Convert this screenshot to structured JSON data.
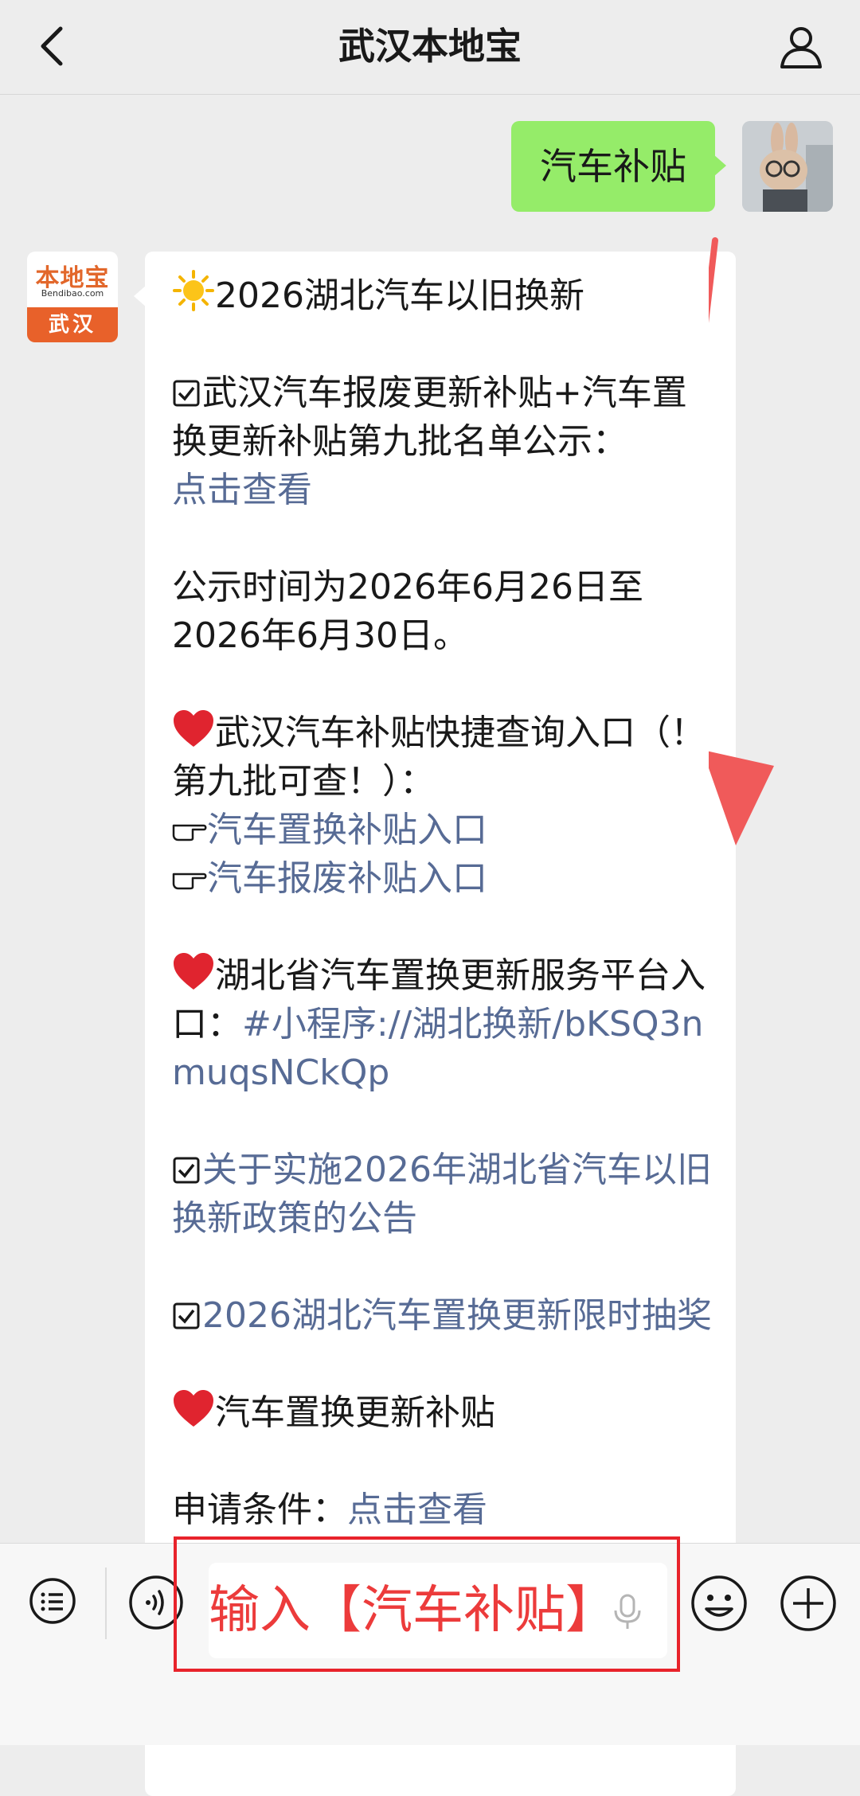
{
  "header": {
    "title": "武汉本地宝",
    "back_icon": "chevron-left-icon",
    "profile_icon": "user-icon"
  },
  "user_message": {
    "text": "汽车补贴",
    "bubble_color": "#95ec69"
  },
  "bot": {
    "avatar": {
      "brand": "本地宝",
      "domain": "Bendibao.com",
      "city": "武汉",
      "brand_color": "#e8612a"
    },
    "heading": "2026湖北汽车以旧换新",
    "line1": "武汉汽车报废更新补贴+汽车置换更新补贴第九批名单公示：",
    "link_view": "点击查看",
    "notice_time": "公示时间为2026年6月26日至2026年6月30日。",
    "query_heading": "武汉汽车补贴快捷查询入口（！第九批可查！）：",
    "link_replace_entry": "汽车置换补贴入口",
    "link_scrap_entry": "汽车报废补贴入口",
    "platform_prefix": "湖北省汽车置换更新服务平台入口：",
    "platform_link": "#小程序://湖北换新/bKSQ3nmuqsNCkQp",
    "link_policy": "关于实施2026年湖北省汽车以旧换新政策的公告",
    "link_lottery": "2026湖北汽车置换更新限时抽奖",
    "subsidy_heading": "汽车置换更新补贴",
    "partial_line_prefix": "申请条件：",
    "partial_line_link": "点击查看",
    "link_color": "#576b95"
  },
  "input_bar": {
    "input_value": "输入【汽车补贴】",
    "menu_icon": "list-menu-icon",
    "voice_icon": "voice-icon",
    "mic_icon": "microphone-icon",
    "emoji_icon": "smiley-icon",
    "plus_icon": "plus-icon"
  },
  "annotation": {
    "arrow_color": "#f05a5a",
    "box_color": "#e8232b"
  }
}
